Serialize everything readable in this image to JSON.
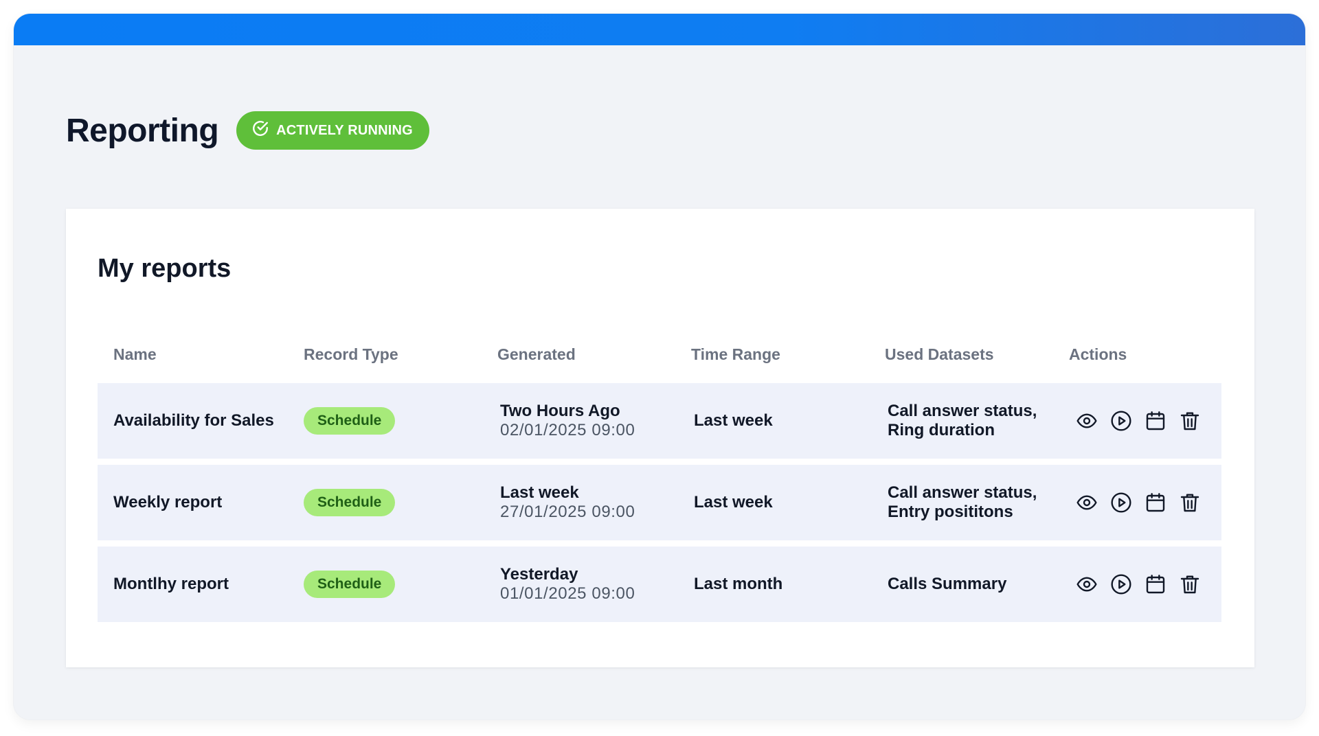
{
  "header": {
    "title": "Reporting",
    "status": "ACTIVELY RUNNING",
    "status_icon": "check-circle-icon"
  },
  "reports": {
    "title": "My reports",
    "columns": [
      "Name",
      "Record Type",
      "Generated",
      "Time Range",
      "Used Datasets",
      "Actions"
    ],
    "rows": [
      {
        "name": "Availability for Sales",
        "type": "Schedule",
        "generated": "Two Hours Ago",
        "generated_at": "02/01/2025 09:00",
        "range": "Last week",
        "datasets_1": "Call answer status,",
        "datasets_2": "Ring duration"
      },
      {
        "name": "Weekly report",
        "type": "Schedule",
        "generated": "Last week",
        "generated_at": "27/01/2025 09:00",
        "range": "Last week",
        "datasets_1": "Call answer status,",
        "datasets_2": "Entry posititons"
      },
      {
        "name": "Montlhy report",
        "type": "Schedule",
        "generated": "Yesterday",
        "generated_at": "01/01/2025 09:00",
        "range": "Last month",
        "datasets_1": "Calls Summary",
        "datasets_2": ""
      }
    ],
    "action_icons": [
      "eye-icon",
      "play-icon",
      "calendar-icon",
      "trash-icon"
    ]
  },
  "colors": {
    "accent": "#0a7cf4",
    "status_green": "#5fbf3a",
    "badge_bg": "#a7ea7a",
    "badge_text": "#1f5f16",
    "row_bg": "#eef1fa"
  }
}
